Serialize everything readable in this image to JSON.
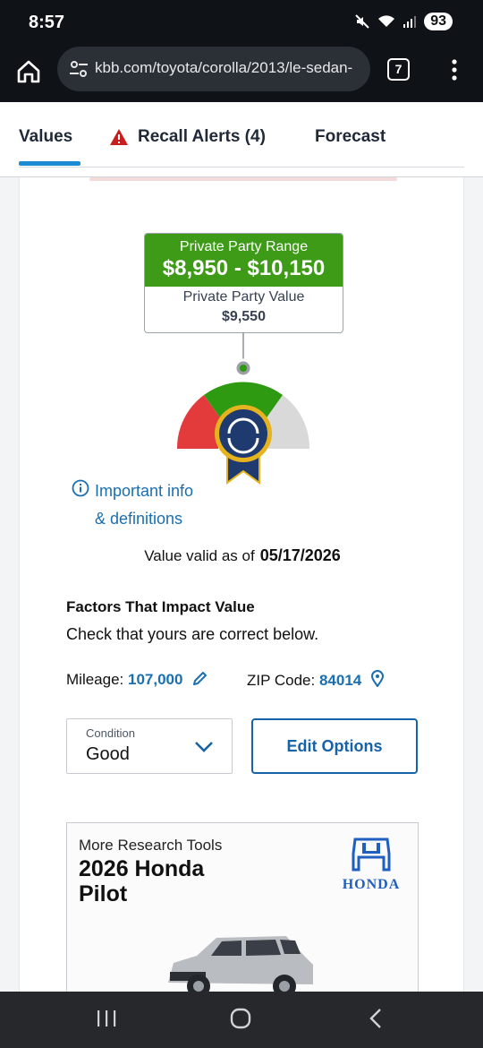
{
  "status_bar": {
    "time": "8:57",
    "battery": "93"
  },
  "browser": {
    "url": "kbb.com/toyota/corolla/2013/le-sedan-",
    "tab_count": "7"
  },
  "tabs": [
    {
      "label": "Values",
      "active": true
    },
    {
      "label": "Recall Alerts (4)",
      "icon": "warning-icon"
    },
    {
      "label": "Forecast"
    }
  ],
  "valuation": {
    "range_label": "Private Party Range",
    "range_value": "$8,950 - $10,150",
    "value_label": "Private Party Value",
    "value": "$9,550",
    "colors": {
      "green": "#3d9b17",
      "red": "#e33b3b",
      "gray": "#d9d9d9",
      "badge_blue": "#1e3a6e",
      "badge_gold": "#e6b31e"
    }
  },
  "info": {
    "line1": "Important info",
    "line2": "& definitions"
  },
  "valid": {
    "label": "Value valid as of",
    "date": "05/17/2026"
  },
  "factors": {
    "title": "Factors That Impact Value",
    "subtitle": "Check that yours are correct below.",
    "mileage_label": "Mileage:",
    "mileage_value": "107,000",
    "zip_label": "ZIP Code:",
    "zip_value": "84014",
    "condition_label": "Condition",
    "condition_value": "Good",
    "edit_options": "Edit Options"
  },
  "ad": {
    "kicker": "More Research Tools",
    "title": "2026 Honda Pilot",
    "brand": "HONDA"
  }
}
